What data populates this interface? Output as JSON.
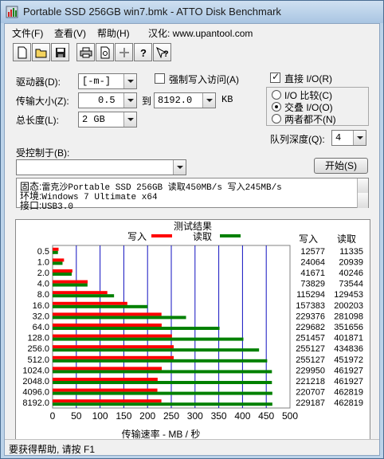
{
  "window": {
    "title": "Portable SSD 256GB win7.bmk - ATTO Disk Benchmark"
  },
  "menu": {
    "file": "文件(F)",
    "view": "查看(V)",
    "help": "帮助(H)",
    "localized": "汉化: www.upantool.com"
  },
  "toolbar": {
    "icons": [
      "new-file-icon",
      "open-folder-icon",
      "save-disk-icon",
      "print-icon",
      "print-preview-icon",
      "move-icon",
      "help-icon",
      "context-help-icon"
    ]
  },
  "settings": {
    "drive_label": "驱动器(D):",
    "drive_value": "[-m-]",
    "transfer_label": "传输大小(Z):",
    "transfer_from": "0.5",
    "transfer_to_label": "到",
    "transfer_to": "8192.0",
    "transfer_unit": "KB",
    "total_label": "总长度(L):",
    "total_value": "2 GB",
    "force_write_label": "强制写入访问(A)",
    "force_write_checked": false,
    "direct_io_label": "直接 I/O(R)",
    "direct_io_checked": true,
    "io_compare_label": "I/O 比较(C)",
    "io_overlap_label": "交叠 I/O(O)",
    "io_neither_label": "两者都不(N)",
    "io_selected": "overlap",
    "queue_label": "队列深度(Q):",
    "queue_value": "4",
    "controlled_label": "受控制于(B):",
    "controlled_value": "",
    "start_button": "开始(S)"
  },
  "description": {
    "lines": [
      {
        "label": "固态:",
        "text": "雷克沙Portable SSD 256GB 读取450MB/s 写入245MB/s"
      },
      {
        "label": "环境:",
        "text": "Windows 7 Ultimate x64"
      },
      {
        "label": "接口:",
        "text": "USB3.0"
      }
    ]
  },
  "results": {
    "title": "测试结果",
    "write_legend": "写入",
    "read_legend": "读取",
    "write_col_header": "写入",
    "read_col_header": "读取",
    "write_color": "#ff0000",
    "read_color": "#008000"
  },
  "chart_data": {
    "type": "bar",
    "title": "测试结果",
    "xlabel": "传输速率 - MB / 秒",
    "xlim": [
      0,
      500
    ],
    "xticks": [
      0,
      50,
      100,
      150,
      200,
      250,
      300,
      350,
      400,
      450,
      500
    ],
    "categories": [
      "0.5",
      "1.0",
      "2.0",
      "4.0",
      "8.0",
      "16.0",
      "32.0",
      "64.0",
      "128.0",
      "256.0",
      "512.0",
      "1024.0",
      "2048.0",
      "4096.0",
      "8192.0"
    ],
    "series": [
      {
        "name": "写入",
        "color": "#ff0000",
        "values_kb_s": [
          12577,
          24064,
          41671,
          73829,
          115294,
          157383,
          229376,
          229682,
          251457,
          255127,
          255127,
          229950,
          221218,
          220707,
          229187
        ]
      },
      {
        "name": "读取",
        "color": "#008000",
        "values_kb_s": [
          11335,
          20939,
          40246,
          73544,
          129453,
          200203,
          281098,
          351656,
          401871,
          434836,
          451972,
          461927,
          461927,
          462819,
          462819
        ]
      }
    ]
  },
  "status": {
    "text": "要获得帮助, 请按 F1"
  }
}
